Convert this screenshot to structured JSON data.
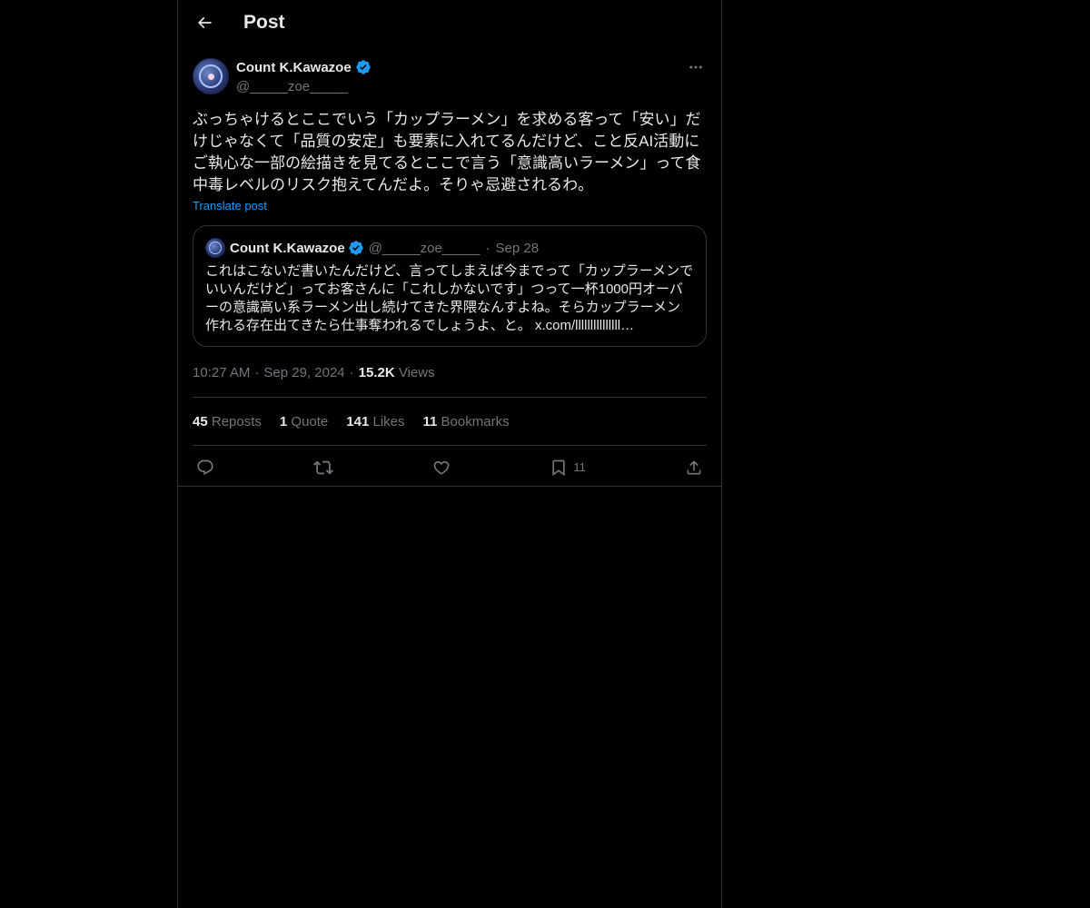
{
  "header": {
    "title": "Post"
  },
  "post": {
    "author_name": "Count K.Kawazoe",
    "author_handle": "@_____zoe_____",
    "text": "ぶっちゃけるとここでいう「カップラーメン」を求める客って「安い」だけじゃなくて「品質の安定」も要素に入れてるんだけど、こと反AI活動にご執心な一部の絵描きを見てるとここで言う「意識高いラーメン」って食中毒レベルのリスク抱えてんだよ。そりゃ忌避されるわ。",
    "translate_label": "Translate post",
    "time": "10:27 AM",
    "date": "Sep 29, 2024",
    "views_count": "15.2K",
    "views_label": "Views",
    "dot": "·"
  },
  "quote": {
    "author_name": "Count K.Kawazoe",
    "author_handle": "@_____zoe_____",
    "date": "Sep 28",
    "separator": "·",
    "text": "これはこないだ書いたんだけど、言ってしまえば今までって「カップラーメンでいいんだけど」ってお客さんに「これしかないです」つって一杯1000円オーバーの意識高い系ラーメン出し続けてきた界隈なんすよね。そらカップラーメン作れる存在出てきたら仕事奪われるでしょうよ、と。 x.com/lllllllllllllll…"
  },
  "stats": {
    "reposts_count": "45",
    "reposts_label": "Reposts",
    "quotes_count": "1",
    "quotes_label": "Quote",
    "likes_count": "141",
    "likes_label": "Likes",
    "bookmarks_count": "11",
    "bookmarks_label": "Bookmarks"
  },
  "actions": {
    "reply_icon": "reply-icon",
    "repost_icon": "repost-icon",
    "like_icon": "heart-icon",
    "bookmark_icon": "bookmark-icon",
    "bookmark_count": "11",
    "share_icon": "share-icon"
  },
  "colors": {
    "background": "#000000",
    "text": "#e7e9ea",
    "secondary": "#71767b",
    "accent": "#1d9bf0",
    "border": "#2f3336"
  }
}
